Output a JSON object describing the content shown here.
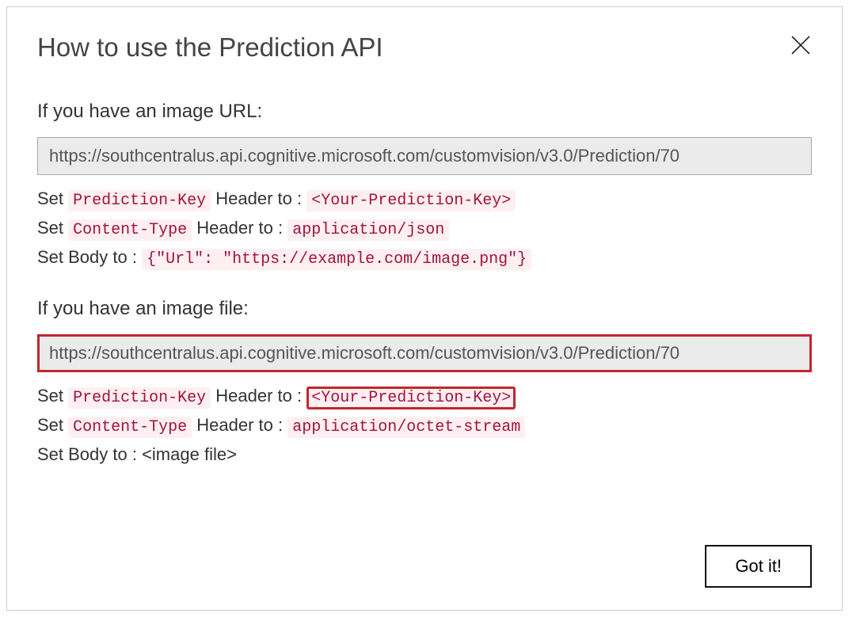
{
  "dialog": {
    "title": "How to use the Prediction API",
    "button_label": "Got it!"
  },
  "section_url": {
    "heading": "If you have an image URL:",
    "endpoint": "https://southcentralus.api.cognitive.microsoft.com/customvision/v3.0/Prediction/70",
    "line1_prefix": "Set ",
    "line1_chip": "Prediction-Key",
    "line1_mid": " Header to : ",
    "line1_chip2": "<Your-Prediction-Key>",
    "line2_prefix": "Set ",
    "line2_chip": "Content-Type",
    "line2_mid": " Header to : ",
    "line2_chip2": "application/json",
    "line3_prefix": "Set Body to : ",
    "line3_chip": "{\"Url\": \"https://example.com/image.png\"}"
  },
  "section_file": {
    "heading": "If you have an image file:",
    "endpoint": "https://southcentralus.api.cognitive.microsoft.com/customvision/v3.0/Prediction/70",
    "line1_prefix": "Set ",
    "line1_chip": "Prediction-Key",
    "line1_mid": " Header to : ",
    "line1_chip2": "<Your-Prediction-Key>",
    "line2_prefix": "Set ",
    "line2_chip": "Content-Type",
    "line2_mid": " Header to : ",
    "line2_chip2": "application/octet-stream",
    "line3": "Set Body to : <image file>"
  }
}
